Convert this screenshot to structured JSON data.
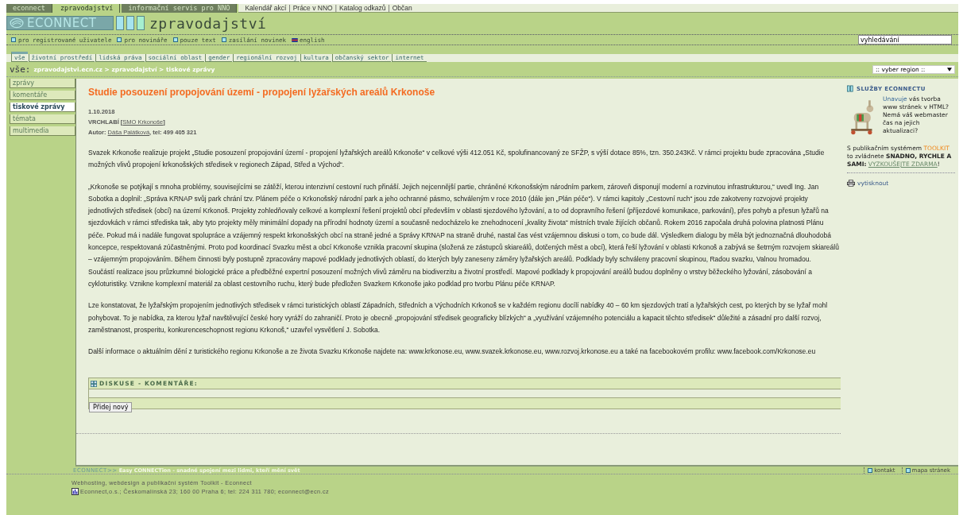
{
  "top_tabs": [
    {
      "label": "econnect",
      "selected": false
    },
    {
      "label": "zpravodajství",
      "selected": true
    },
    {
      "label": "informační servis pro NNO",
      "selected": false
    }
  ],
  "top_links": [
    "Kalendář akcí",
    "Práce v NNO",
    "Katalog odkazů",
    "Občan"
  ],
  "top_link_separator": "|",
  "logo": {
    "text": "ECONNECT"
  },
  "section_title": "zpravodajství",
  "user_links": [
    {
      "label": "pro registrované uživatele",
      "kind": "square"
    },
    {
      "label": "pro novináře",
      "kind": "square"
    },
    {
      "label": "pouze text",
      "kind": "square"
    },
    {
      "label": "zasílání novinek",
      "kind": "square"
    },
    {
      "label": "english",
      "kind": "flag"
    }
  ],
  "search": {
    "value": "vyhledávání"
  },
  "categories": [
    {
      "label": "vše",
      "selected": true
    },
    {
      "label": "životní prostředí",
      "selected": false
    },
    {
      "label": "lidská práva",
      "selected": false
    },
    {
      "label": "sociální oblast",
      "selected": false
    },
    {
      "label": "gender",
      "selected": false
    },
    {
      "label": "regionální rozvoj",
      "selected": false
    },
    {
      "label": "kultura",
      "selected": false
    },
    {
      "label": "občanský sektor",
      "selected": false
    },
    {
      "label": "internet",
      "selected": false
    }
  ],
  "breadcrumb": {
    "label": "vše:",
    "path": "zpravodajstvi.ecn.cz > zpravodajství > tiskové zprávy"
  },
  "region_select": {
    "value": ":: vyber region ::"
  },
  "sidebar": {
    "items": [
      {
        "label": "zprávy",
        "selected": false
      },
      {
        "label": "komentáře",
        "selected": false
      },
      {
        "label": "tiskové zprávy",
        "selected": true
      },
      {
        "label": "témata",
        "selected": false
      },
      {
        "label": "multimedia",
        "selected": false
      }
    ]
  },
  "article": {
    "title": "Studie posouzení propojování území - propojení lyžařských areálů Krkonoše",
    "date": "1.10.2018",
    "meta": [
      [
        {
          "kind": "text",
          "text": "VRCHLABÍ ["
        },
        {
          "kind": "link",
          "text": "SMO Krkonoše"
        },
        {
          "kind": "text",
          "text": "]"
        }
      ],
      [
        {
          "kind": "text",
          "text": "Autor: "
        },
        {
          "kind": "link",
          "text": "Dáša Palátková"
        },
        {
          "kind": "text",
          "text": ", tel: 499 405 321"
        }
      ]
    ],
    "paragraphs": [
      "Svazek Krkonoše realizuje projekt „Studie posouzení propojování území - propojení lyžařských areálů Krkonoše“ v celkové výši 412.051 Kč, spolufinancovaný ze SFŽP, s výší dotace 85%, tzn. 350.243Kč. V rámci projektu bude zpracována „Studie možných vlivů propojení krkonošských středisek v regionech Západ, Střed a Východ“.",
      "„Krkonoše se potýkají s mnoha problémy, souvisejícími se zátěží, kterou intenzivní cestovní ruch přináší. Jejich nejcennější partie, chráněné Krkonošským národním parkem, zároveň disponují moderní a rozvinutou infrastrukturou,“ uvedl Ing. Jan Sobotka a doplnil: „Správa KRNAP svůj park chrání tzv. Plánem péče o Krkonošský národní park a jeho ochranné pásmo, schváleným v roce 2010 (dále jen „Plán péče“). V rámci kapitoly „Cestovní ruch“ jsou zde zakotveny rozvojové projekty jednotlivých středisek (obcí) na území Krkonoš. Projekty zohledňovaly celkové a komplexní řešení projektů obcí především v oblasti sjezdového lyžování, a to od dopravního řešení (příjezdové komunikace, parkování), přes pohyb a přesun lyžařů na sjezdovkách v rámci střediska tak, aby tyto projekty měly minimální dopady na přírodní hodnoty území a současně nedocházelo ke znehodnocení „kvality života“ místních trvale žijících občanů. Rokem 2016 započala druhá polovina platnosti Plánu péče. Pokud má i nadále fungovat spolupráce a vzájemný respekt krkonošských obcí na straně jedné a Správy KRNAP na straně druhé, nastal čas vést vzájemnou diskusi o tom, co bude dál. Výsledkem dialogu by měla být jednoznačná dlouhodobá koncepce, respektovaná zúčastněnými. Proto pod koordinací Svazku měst a obcí Krkonoše vznikla pracovní skupina (složená ze zástupců skiareálů, dotčených měst a obcí), která řeší lyžování v oblasti Krkonoš a zabývá se šetrným rozvojem skiareálů – vzájemným propojováním. Během činnosti byly postupně zpracovány mapové podklady jednotlivých oblastí, do kterých byly zaneseny záměry lyžařských areálů. Podklady byly schváleny pracovní skupinou, Radou svazku, Valnou hromadou. Součástí realizace jsou průzkumné biologické práce a předběžné expertní posouzení možných vlivů záměru na biodiverzitu a životní prostředí. Mapové podklady k propojování areálů budou doplněny o vrstvy běžeckého lyžování, zásobování a cykloturistiky. Vznikne komplexní materiál za oblast cestovního ruchu, který bude předložen Svazkem Krkonoše jako podklad pro tvorbu Plánu péče KRNAP.",
      "Lze konstatovat, že lyžařským propojením jednotlivých středisek v rámci turistických oblastí Západních, Středních a Východních Krkonoš se v každém regionu docílí nabídky 40 – 60 km sjezdových tratí a lyžařských cest, po kterých by se lyžař mohl pohybovat. To je nabídka, za kterou lyžař navštěvující české hory vyráží do zahraničí. Proto je obecně „propojování středisek geograficky blízkých“ a „využívání vzájemného potenciálu a kapacit těchto středisek“ důležité a zásadní pro další rozvoj, zaměstnanost, prosperitu, konkurenceschopnost regionu Krkonoš,“ uzavřel vysvětlení J. Sobotka.",
      "Další informace o aktuálním dění z turistického regionu Krkonoše a ze života Svazku Krkonoše najdete na: www.krkonose.eu, www.svazek.krkonose.eu, www.rozvoj.krkonose.eu a také na facebookovém profilu: www.facebook.com/Krkonose.eu"
    ]
  },
  "discussion": {
    "title": "DISKUSE - KOMENTÁŘE:",
    "button": "Přidej nový"
  },
  "promo": {
    "title": "SLUŽBY ECONNECTU",
    "lead_link": "Unavuje",
    "text1": "vás tvorba www stránek v HTML? Nemá váš webmaster čas na jejich aktualizaci?",
    "text2": "S publikačním systémem",
    "highlight": "TOOLKIT",
    "text3": "to zvládnete",
    "emphasis": "SNADNO, RYCHLE A SAMI:",
    "link": "VYZKOUŠEJTE ZDARMA",
    "tail": "!"
  },
  "print_link": "vytisknout",
  "footer": {
    "logo": "ECONNECT>>",
    "slogan": "Easy CONNECTion - snadné spojení mezi lidmi, kteří mění svět",
    "links": [
      "kontakt",
      "mapa stránek"
    ],
    "line1": "Webhosting, webdesign a publikační systém Toolkit - Econnect",
    "line2": "Econnect,o.s.; Českomalínská 23; 160 00 Praha 6; tel: 224 311 780; econnect@ecn.cz"
  }
}
